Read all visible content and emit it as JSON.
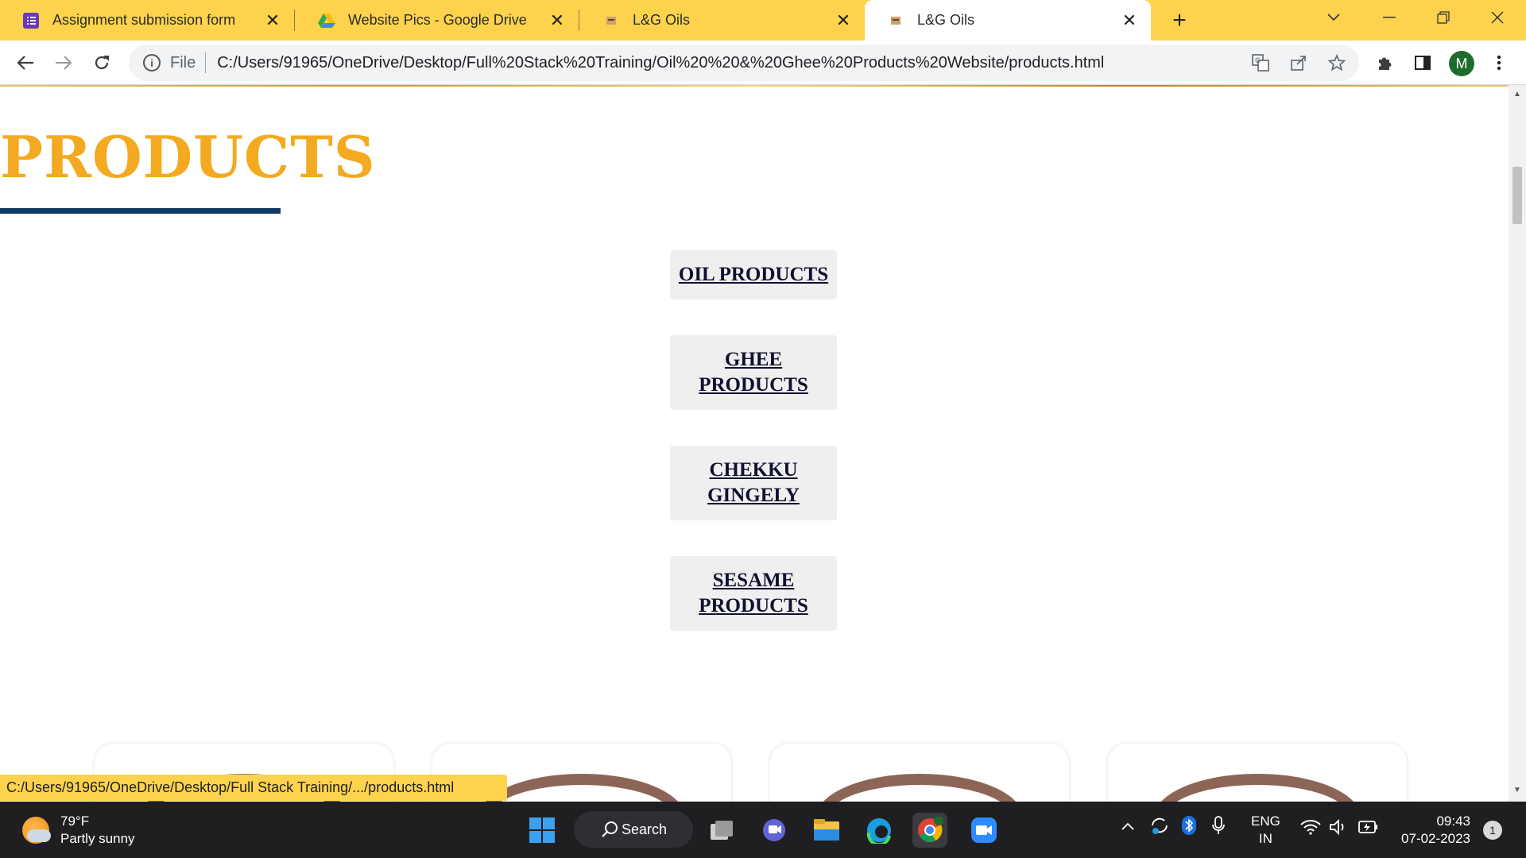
{
  "browser": {
    "tabs": [
      {
        "title": "Assignment submission form",
        "icon": "google-forms-icon"
      },
      {
        "title": "Website Pics - Google Drive",
        "icon": "google-drive-icon"
      },
      {
        "title": "L&G Oils",
        "icon": "site-favicon"
      },
      {
        "title": "L&G Oils",
        "icon": "site-favicon",
        "active": true
      }
    ],
    "omnibox": {
      "scheme_label": "File",
      "url": "C:/Users/91965/OneDrive/Desktop/Full%20Stack%20Training/Oil%20%20&%20Ghee%20Products%20Website/products.html"
    },
    "profile_initial": "M",
    "status_url": "C:/Users/91965/OneDrive/Desktop/Full Stack Training/.../products.html"
  },
  "page": {
    "title": "PRODUCTS",
    "categories": [
      {
        "label": "OIL PRODUCTS"
      },
      {
        "label": "GHEE PRODUCTS"
      },
      {
        "label": "CHEKKU GINGELY"
      },
      {
        "label": "SESAME PRODUCTS"
      }
    ]
  },
  "colors": {
    "tabstrip": "#fdd34e",
    "title": "#f3aa20",
    "underline": "#0f3b66"
  },
  "taskbar": {
    "weather_temp": "79°F",
    "weather_desc": "Partly sunny",
    "search_label": "Search",
    "lang_line1": "ENG",
    "lang_line2": "IN",
    "time": "09:43",
    "date": "07-02-2023",
    "notification_count": "1"
  }
}
